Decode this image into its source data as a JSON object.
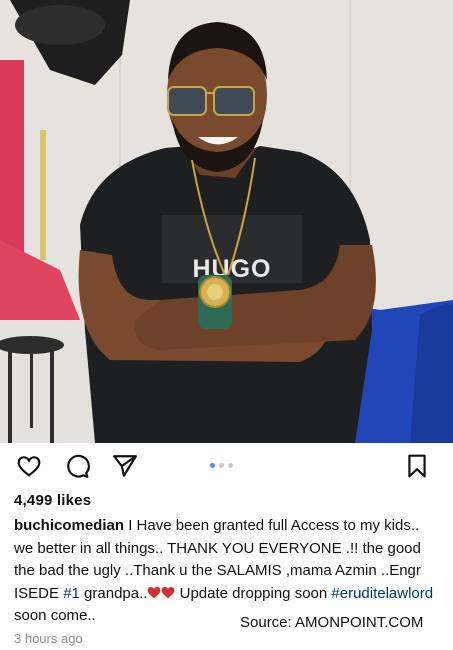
{
  "post": {
    "image_alt": "",
    "shirt_text": "HUGO",
    "carousel": {
      "count": 3,
      "active": 1
    }
  },
  "actions": {
    "like_icon": "heart-icon",
    "comment_icon": "comment-icon",
    "share_icon": "send-icon",
    "save_icon": "bookmark-icon"
  },
  "likes_text": "4,499 likes",
  "caption": {
    "username": "buchicomedian",
    "text_part1": " I Have been granted full Access to my kids.. we better in all things.. THANK YOU EVERYONE .!! the good the bad the ugly ..Thank u the SALAMIS ,mama Azmin ..Engr ISEDE ",
    "hashtag1": "#1",
    "text_part2": " grandpa..",
    "text_part3": " Update dropping soon ",
    "hashtag2": "#eruditelawlord",
    "text_part4": " soon come.."
  },
  "watermark": "Source: AMONPOINT.COM",
  "timestamp": "3 hours ago",
  "colors": {
    "link": "#00376b",
    "heart": "#d32f2f",
    "dot_active": "#3897f0"
  }
}
